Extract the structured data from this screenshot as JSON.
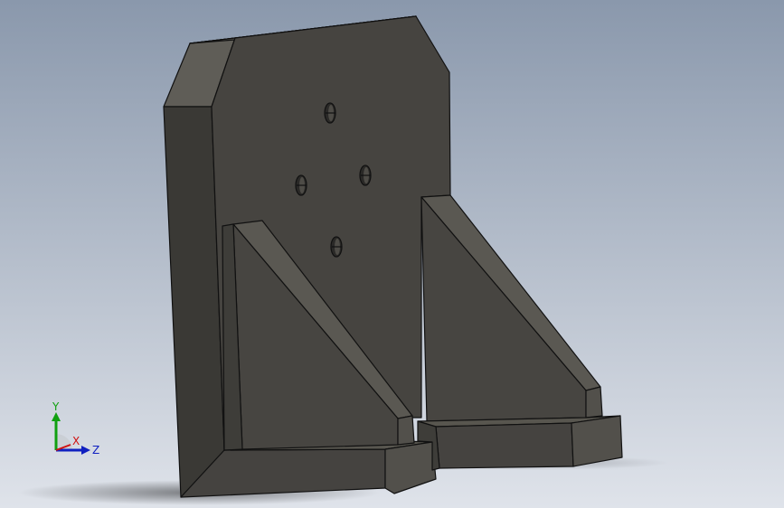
{
  "viewport": {
    "background_top": "#8a98ac",
    "background_bottom": "#dfe3ea"
  },
  "model": {
    "colors": {
      "face_front": "#464440",
      "face_side": "#52504b",
      "face_top": "#5f5d57",
      "face_dark": "#3a3935",
      "edge": "#111111",
      "hole": "#2a2927"
    }
  },
  "triad": {
    "x_label": "X",
    "y_label": "Y",
    "z_label": "Z",
    "x_color": "#d01010",
    "y_color": "#10a010",
    "z_color": "#1020c0"
  }
}
